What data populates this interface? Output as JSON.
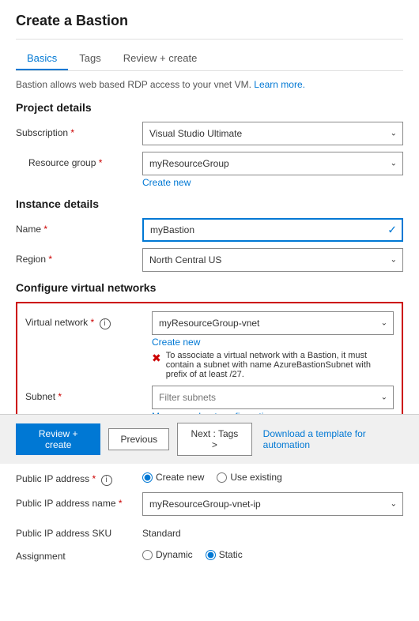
{
  "page": {
    "title": "Create a Bastion",
    "description": "Bastion allows web based RDP access to your vnet VM.",
    "learn_more": "Learn more."
  },
  "tabs": [
    {
      "label": "Basics",
      "active": true
    },
    {
      "label": "Tags",
      "active": false
    },
    {
      "label": "Review + create",
      "active": false
    }
  ],
  "sections": {
    "project": {
      "title": "Project details",
      "subscription_label": "Subscription",
      "subscription_value": "Visual Studio Ultimate",
      "resource_group_label": "Resource group",
      "resource_group_value": "myResourceGroup",
      "create_new_label": "Create new"
    },
    "instance": {
      "title": "Instance details",
      "name_label": "Name",
      "name_value": "myBastion",
      "region_label": "Region",
      "region_value": "North Central US"
    },
    "virtual_networks": {
      "title": "Configure virtual networks",
      "vnet_label": "Virtual network",
      "vnet_value": "myResourceGroup-vnet",
      "create_new_label": "Create new",
      "error_message": "To associate a virtual network with a Bastion, it must contain a subnet with name AzureBastionSubnet with prefix of at least /27.",
      "subnet_label": "Subnet",
      "subnet_placeholder": "Filter subnets",
      "manage_link": "Manage subnet configuration"
    },
    "public_ip": {
      "title": "Public IP address",
      "ip_label": "Public IP address",
      "ip_create_new": "Create new",
      "ip_use_existing": "Use existing",
      "ip_name_label": "Public IP address name",
      "ip_name_value": "myResourceGroup-vnet-ip",
      "ip_sku_label": "Public IP address SKU",
      "ip_sku_value": "Standard",
      "assignment_label": "Assignment",
      "assignment_dynamic": "Dynamic",
      "assignment_static": "Static"
    }
  },
  "footer": {
    "review_create": "Review + create",
    "previous": "Previous",
    "next": "Next : Tags >",
    "download": "Download a template for automation"
  }
}
